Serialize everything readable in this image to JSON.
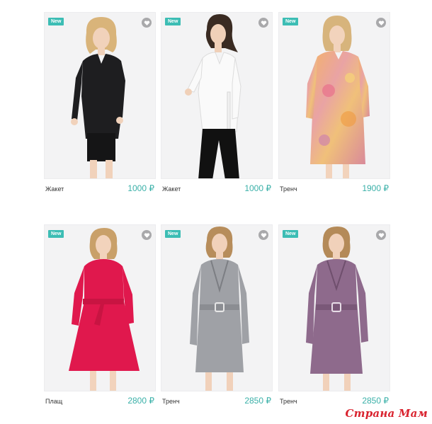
{
  "colors": {
    "accent": "#3cbdb4",
    "price": "#3ab0a8",
    "fav_bg": "#a9a9ab",
    "watermark": "#d9232f"
  },
  "products": [
    {
      "name": "Жакет",
      "price": "1000 ₽",
      "badge": "New",
      "icon": "heart-icon",
      "garment": "black short jacket"
    },
    {
      "name": "Жакет",
      "price": "1000 ₽",
      "badge": "New",
      "icon": "heart-icon",
      "garment": "white wrap jacket"
    },
    {
      "name": "Тренч",
      "price": "1900 ₽",
      "badge": "New",
      "icon": "heart-icon",
      "garment": "floral print trench coat"
    },
    {
      "name": "Плащ",
      "price": "2800 ₽",
      "badge": "New",
      "icon": "heart-icon",
      "garment": "pink belted coat"
    },
    {
      "name": "Тренч",
      "price": "2850 ₽",
      "badge": "New",
      "icon": "heart-icon",
      "garment": "grey belted trench"
    },
    {
      "name": "Тренч",
      "price": "2850 ₽",
      "badge": "New",
      "icon": "heart-icon",
      "garment": "mauve belted trench"
    }
  ],
  "watermark": "Страна Мам"
}
